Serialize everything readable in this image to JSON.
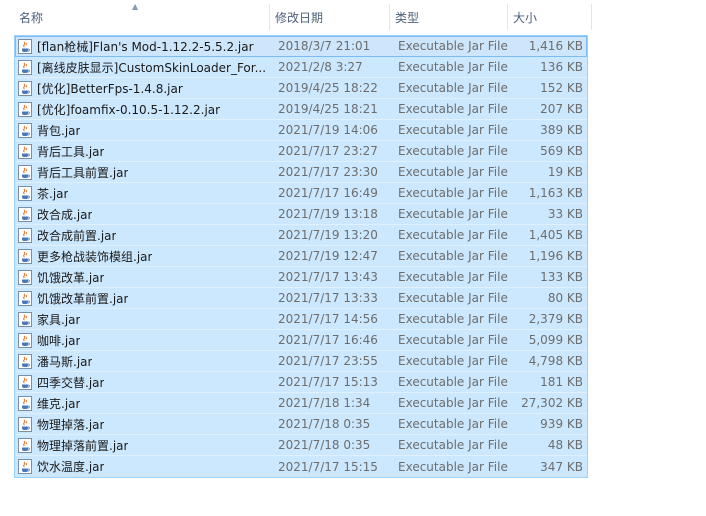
{
  "columns": {
    "name": "名称",
    "date": "修改日期",
    "type": "类型",
    "size": "大小"
  },
  "files": [
    {
      "name": "[flan枪械]Flan's Mod-1.12.2-5.5.2.jar",
      "date": "2018/3/7 21:01",
      "type": "Executable Jar File",
      "size": "1,416 KB"
    },
    {
      "name": "[离线皮肤显示]CustomSkinLoader_For...",
      "date": "2021/2/8 3:27",
      "type": "Executable Jar File",
      "size": "136 KB"
    },
    {
      "name": "[优化]BetterFps-1.4.8.jar",
      "date": "2019/4/25 18:22",
      "type": "Executable Jar File",
      "size": "152 KB"
    },
    {
      "name": "[优化]foamfix-0.10.5-1.12.2.jar",
      "date": "2019/4/25 18:21",
      "type": "Executable Jar File",
      "size": "207 KB"
    },
    {
      "name": "背包.jar",
      "date": "2021/7/19 14:06",
      "type": "Executable Jar File",
      "size": "389 KB"
    },
    {
      "name": "背后工具.jar",
      "date": "2021/7/17 23:27",
      "type": "Executable Jar File",
      "size": "569 KB"
    },
    {
      "name": "背后工具前置.jar",
      "date": "2021/7/17 23:30",
      "type": "Executable Jar File",
      "size": "19 KB"
    },
    {
      "name": "茶.jar",
      "date": "2021/7/17 16:49",
      "type": "Executable Jar File",
      "size": "1,163 KB"
    },
    {
      "name": "改合成.jar",
      "date": "2021/7/19 13:18",
      "type": "Executable Jar File",
      "size": "33 KB"
    },
    {
      "name": "改合成前置.jar",
      "date": "2021/7/19 13:20",
      "type": "Executable Jar File",
      "size": "1,405 KB"
    },
    {
      "name": "更多枪战装饰模组.jar",
      "date": "2021/7/19 12:47",
      "type": "Executable Jar File",
      "size": "1,196 KB"
    },
    {
      "name": "饥饿改革.jar",
      "date": "2021/7/17 13:43",
      "type": "Executable Jar File",
      "size": "133 KB"
    },
    {
      "name": "饥饿改革前置.jar",
      "date": "2021/7/17 13:33",
      "type": "Executable Jar File",
      "size": "80 KB"
    },
    {
      "name": "家具.jar",
      "date": "2021/7/17 14:56",
      "type": "Executable Jar File",
      "size": "2,379 KB"
    },
    {
      "name": "咖啡.jar",
      "date": "2021/7/17 16:46",
      "type": "Executable Jar File",
      "size": "5,099 KB"
    },
    {
      "name": "潘马斯.jar",
      "date": "2021/7/17 23:55",
      "type": "Executable Jar File",
      "size": "4,798 KB"
    },
    {
      "name": "四季交替.jar",
      "date": "2021/7/17 15:13",
      "type": "Executable Jar File",
      "size": "181 KB"
    },
    {
      "name": "维克.jar",
      "date": "2021/7/18 1:34",
      "type": "Executable Jar File",
      "size": "27,302 KB"
    },
    {
      "name": "物理掉落.jar",
      "date": "2021/7/18 0:35",
      "type": "Executable Jar File",
      "size": "939 KB"
    },
    {
      "name": "物理掉落前置.jar",
      "date": "2021/7/18 0:35",
      "type": "Executable Jar File",
      "size": "48 KB"
    },
    {
      "name": "饮水温度.jar",
      "date": "2021/7/17 15:15",
      "type": "Executable Jar File",
      "size": "347 KB"
    }
  ],
  "icon": "java-jar-file-icon",
  "colors": {
    "selection_bg": "#cce8ff",
    "selection_border": "#99d1ff",
    "header_text": "#4c607a"
  }
}
